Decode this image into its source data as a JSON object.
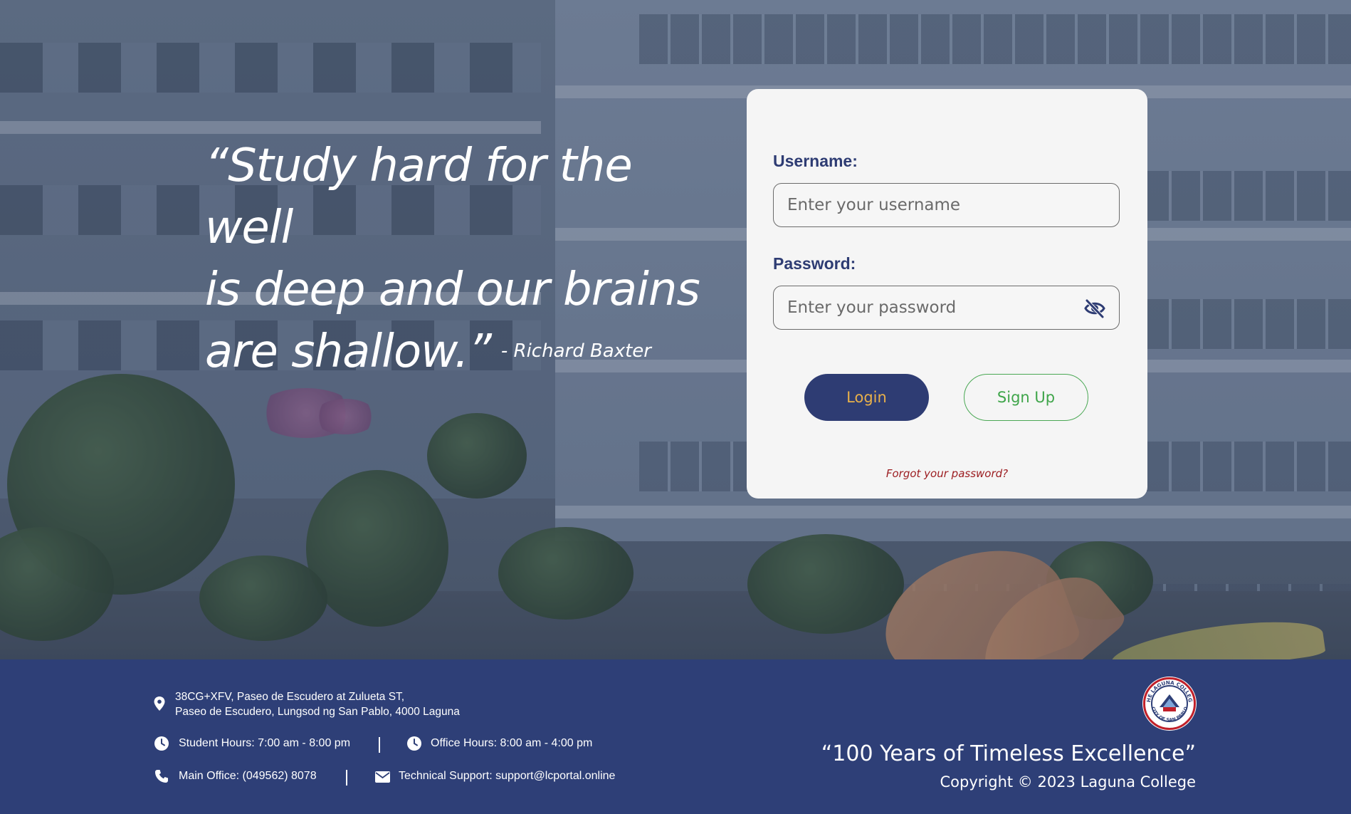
{
  "quote": {
    "lines": [
      "“Study hard for the well",
      "is deep and our brains",
      "are shallow.”"
    ],
    "author": "- Richard Baxter"
  },
  "login": {
    "username_label": "Username:",
    "username_placeholder": "Enter your username",
    "username_value": "",
    "password_label": "Password:",
    "password_placeholder": "Enter your password",
    "password_value": "",
    "password_toggle_icon": "eye-slash-icon",
    "login_label": "Login",
    "signup_label": "Sign Up",
    "forgot_label": "Forgot your password?"
  },
  "footer": {
    "address_line1": "38CG+XFV, Paseo de Escudero at Zulueta ST,",
    "address_line2": "Paseo de Escudero, Lungsod ng San Pablo, 4000 Laguna",
    "student_hours": "Student Hours: 7:00 am - 8:00 pm",
    "office_hours": "Office Hours: 8:00 am - 4:00 pm",
    "main_office": "Main Office: (049562) 8078",
    "tech_support": "Technical Support: support@lcportal.online",
    "tagline": "“100 Years of Timeless Excellence”",
    "copyright": "Copyright © 2023 Laguna College",
    "seal_text_top": "THE LAGUNA COLLEGE",
    "seal_text_bottom": "CITY OF SAN PABLO"
  },
  "colors": {
    "primary": "#2e3c73",
    "login_text": "#e8b04a",
    "signup": "#3fa54a",
    "forgot": "#9b1b1f",
    "footer_bg": "#2e3f77"
  }
}
